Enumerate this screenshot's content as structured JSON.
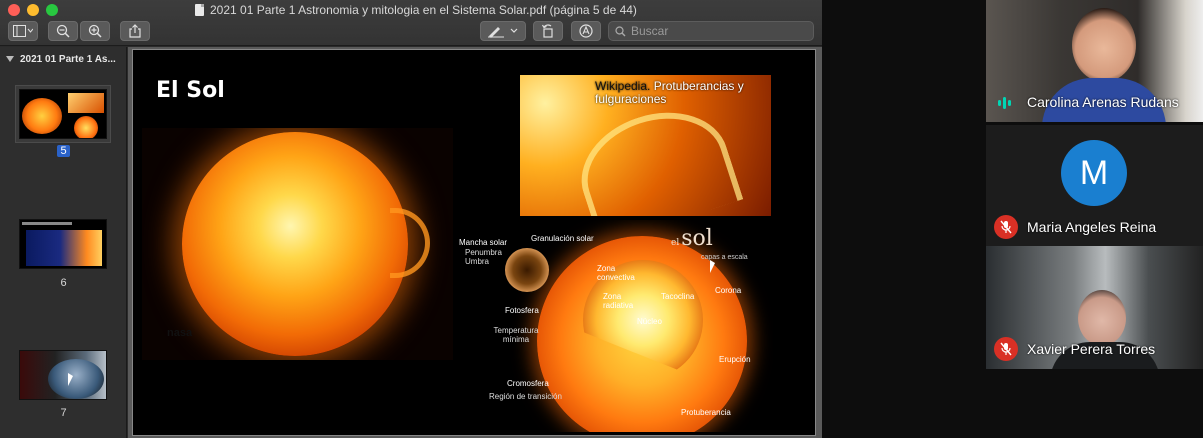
{
  "viewer": {
    "window_title": "2021 01 Parte 1 Astronomia y mitologia en el Sistema Solar.pdf (página 5 de 44)",
    "toolbar": {
      "sidebar_toggle_icon": "sidebar-icon",
      "zoom_out_icon": "zoom-out-icon",
      "zoom_in_icon": "zoom-in-icon",
      "share_icon": "share-icon",
      "markup_icon": "pen-icon",
      "rotate_icon": "rotate-icon",
      "annotate_icon": "annotate-icon",
      "search_placeholder": "Buscar"
    },
    "sidebar": {
      "header": "2021 01 Parte 1 As...",
      "pages": [
        {
          "number": "5",
          "selected": true
        },
        {
          "number": "6",
          "selected": false
        },
        {
          "number": "7",
          "selected": false
        }
      ]
    },
    "slide": {
      "title": "El Sol",
      "photo_credit": "nasa",
      "prominence_caption_source": "Wikipedia.",
      "prominence_caption": "Protuberancias y fulguraciones",
      "diagram": {
        "heading_small": "el",
        "heading": "sol",
        "subheading": "capas a escala",
        "labels": {
          "sunspot": "Mancha solar",
          "penumbra": "Penumbra",
          "umbra": "Umbra",
          "granulation": "Granulación solar",
          "convective": "Zona convectiva",
          "radiative": "Zona radiativa",
          "tachocline": "Tacoclina",
          "core": "Núcleo",
          "corona": "Corona",
          "photosphere": "Fotosfera",
          "min_temp": "Temperatura mínima",
          "eruption": "Erupción",
          "chromosphere": "Cromosfera",
          "transition": "Región de transición",
          "prominence": "Protuberancia"
        }
      }
    }
  },
  "participants": [
    {
      "name": "Carolina Arenas Rudans",
      "status": "speaking"
    },
    {
      "name": "Maria Angeles Reina",
      "status": "muted",
      "avatar_letter": "M",
      "avatar_color": "#1a7fd0"
    },
    {
      "name": "Xavier Perera Torres",
      "status": "muted"
    }
  ],
  "colors": {
    "muted_badge": "#d93025",
    "speaking_indicator": "#00d6b5",
    "selected_page": "#2a62c9"
  }
}
